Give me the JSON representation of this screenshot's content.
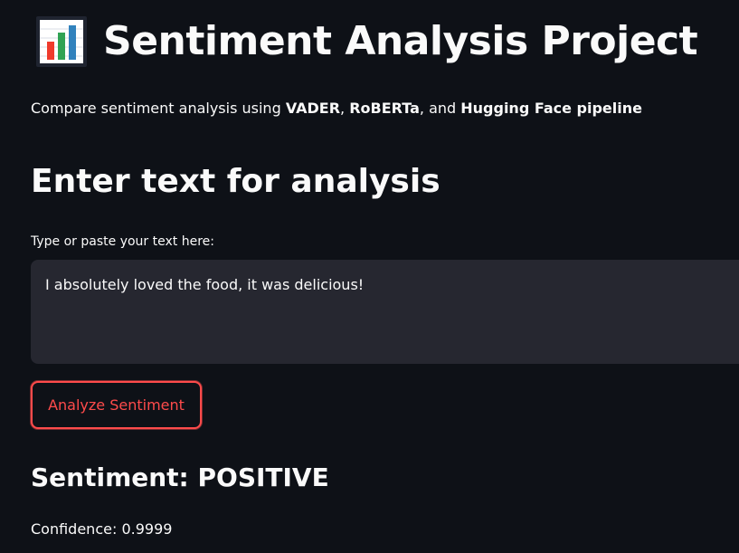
{
  "header": {
    "title": "Sentiment Analysis Project",
    "icon": "bar-chart-icon",
    "subtitle": {
      "prefix": "Compare sentiment analysis using ",
      "model_vader": "VADER",
      "sep_1": ", ",
      "model_roberta": "RoBERTa",
      "sep_2": ", and ",
      "model_hf": "Hugging Face pipeline"
    }
  },
  "input_section": {
    "heading": "Enter text for analysis",
    "label": "Type or paste your text here:",
    "value": "I absolutely loved the food, it was delicious!"
  },
  "actions": {
    "analyze_label": "Analyze Sentiment"
  },
  "result": {
    "sentiment_text": "Sentiment: POSITIVE",
    "confidence_text": "Confidence: 0.9999"
  },
  "colors": {
    "background": "#0e1117",
    "text": "#fafafa",
    "input_background": "#262730",
    "accent": "#ff4b4b"
  }
}
